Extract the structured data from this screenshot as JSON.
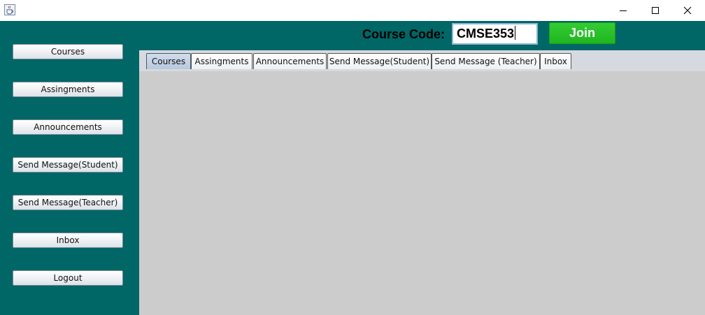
{
  "window": {
    "icons": {
      "app": "java-cup-icon",
      "minimize": "minimize-icon",
      "maximize": "maximize-icon",
      "close": "close-icon"
    }
  },
  "sidebar": {
    "items": [
      {
        "label": "Courses"
      },
      {
        "label": "Assingments"
      },
      {
        "label": "Announcements"
      },
      {
        "label": "Send Message(Student)"
      },
      {
        "label": "Send Message(Teacher)"
      },
      {
        "label": "Inbox"
      },
      {
        "label": "Logout"
      }
    ]
  },
  "header": {
    "course_code_label": "Course Code:",
    "course_code_value": "CMSE353",
    "join_label": "Join"
  },
  "tabs": [
    {
      "label": "Courses",
      "selected": true
    },
    {
      "label": "Assingments",
      "selected": false
    },
    {
      "label": "Announcements",
      "selected": false
    },
    {
      "label": "Send Message(Student)",
      "selected": false
    },
    {
      "label": "Send Message (Teacher)",
      "selected": false
    },
    {
      "label": "Inbox",
      "selected": false
    }
  ],
  "colors": {
    "background": "#006666",
    "tab_panel": "#cccccc",
    "join_button": "#22bb22"
  }
}
